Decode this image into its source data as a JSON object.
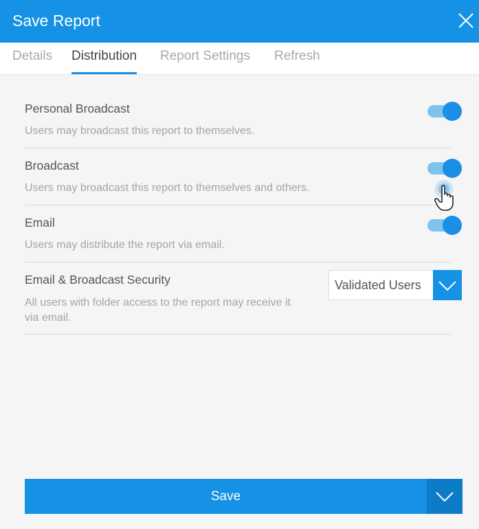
{
  "dialog": {
    "title": "Save Report"
  },
  "tabs": [
    {
      "label": "Details",
      "active": false
    },
    {
      "label": "Distribution",
      "active": true
    },
    {
      "label": "Report Settings",
      "active": false
    },
    {
      "label": "Refresh",
      "active": false
    }
  ],
  "settings": [
    {
      "label": "Personal Broadcast",
      "description": "Users may broadcast this report to themselves.",
      "enabled": true
    },
    {
      "label": "Broadcast",
      "description": "Users may broadcast this report to themselves and others.",
      "enabled": true
    },
    {
      "label": "Email",
      "description": "Users may distribute the report via email.",
      "enabled": true
    }
  ],
  "security": {
    "label": "Email & Broadcast Security",
    "description": "All users with folder access to the report may receive it via email.",
    "selected": "Validated Users"
  },
  "footer": {
    "save_label": "Save"
  },
  "colors": {
    "accent": "#1591e5",
    "toggle_track": "#7ec2ee",
    "toggle_knob": "#1a8fe3"
  },
  "icons": [
    "close-icon",
    "chevron-down-icon",
    "hand-pointer-icon"
  ]
}
